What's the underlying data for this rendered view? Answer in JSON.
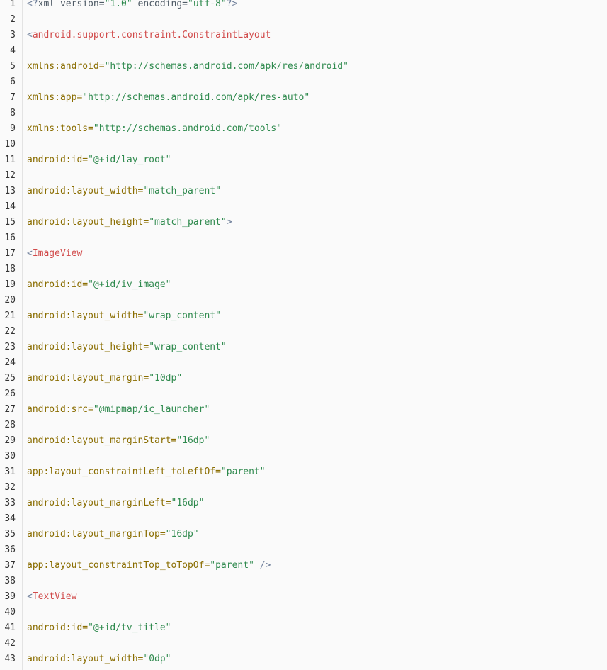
{
  "colors": {
    "background": "#fafafa",
    "line_number": "#333333",
    "gutter_border": "#e3e3e3",
    "punctuation": "#6f7f9a",
    "tag": "#d14a4a",
    "attribute": "#8a6d00",
    "string": "#2f8a4e",
    "plain_text": "#4f5b66"
  },
  "lines": [
    {
      "no": "1",
      "tokens": [
        {
          "type": "punct",
          "text": "<?"
        },
        {
          "type": "text",
          "text": "xml version="
        },
        {
          "type": "string",
          "text": "\"1.0\""
        },
        {
          "type": "text",
          "text": " encoding="
        },
        {
          "type": "string",
          "text": "\"utf-8\""
        },
        {
          "type": "punct",
          "text": "?>"
        }
      ]
    },
    {
      "no": "2",
      "tokens": []
    },
    {
      "no": "3",
      "tokens": [
        {
          "type": "punct",
          "text": "<"
        },
        {
          "type": "tag",
          "text": "android.support.constraint.ConstraintLayout"
        }
      ]
    },
    {
      "no": "4",
      "tokens": []
    },
    {
      "no": "5",
      "tokens": [
        {
          "type": "attr",
          "text": "xmlns:android="
        },
        {
          "type": "string",
          "text": "\"http://schemas.android.com/apk/res/android\""
        }
      ]
    },
    {
      "no": "6",
      "tokens": []
    },
    {
      "no": "7",
      "tokens": [
        {
          "type": "attr",
          "text": "xmlns:app="
        },
        {
          "type": "string",
          "text": "\"http://schemas.android.com/apk/res-auto\""
        }
      ]
    },
    {
      "no": "8",
      "tokens": []
    },
    {
      "no": "9",
      "tokens": [
        {
          "type": "attr",
          "text": "xmlns:tools="
        },
        {
          "type": "string",
          "text": "\"http://schemas.android.com/tools\""
        }
      ]
    },
    {
      "no": "10",
      "tokens": []
    },
    {
      "no": "11",
      "tokens": [
        {
          "type": "attr",
          "text": "android:id="
        },
        {
          "type": "string",
          "text": "\"@+id/lay_root\""
        }
      ]
    },
    {
      "no": "12",
      "tokens": []
    },
    {
      "no": "13",
      "tokens": [
        {
          "type": "attr",
          "text": "android:layout_width="
        },
        {
          "type": "string",
          "text": "\"match_parent\""
        }
      ]
    },
    {
      "no": "14",
      "tokens": []
    },
    {
      "no": "15",
      "tokens": [
        {
          "type": "attr",
          "text": "android:layout_height="
        },
        {
          "type": "string",
          "text": "\"match_parent\""
        },
        {
          "type": "punct",
          "text": ">"
        }
      ]
    },
    {
      "no": "16",
      "tokens": []
    },
    {
      "no": "17",
      "tokens": [
        {
          "type": "punct",
          "text": "<"
        },
        {
          "type": "tag",
          "text": "ImageView"
        }
      ]
    },
    {
      "no": "18",
      "tokens": []
    },
    {
      "no": "19",
      "tokens": [
        {
          "type": "attr",
          "text": "android:id="
        },
        {
          "type": "string",
          "text": "\"@+id/iv_image\""
        }
      ]
    },
    {
      "no": "20",
      "tokens": []
    },
    {
      "no": "21",
      "tokens": [
        {
          "type": "attr",
          "text": "android:layout_width="
        },
        {
          "type": "string",
          "text": "\"wrap_content\""
        }
      ]
    },
    {
      "no": "22",
      "tokens": []
    },
    {
      "no": "23",
      "tokens": [
        {
          "type": "attr",
          "text": "android:layout_height="
        },
        {
          "type": "string",
          "text": "\"wrap_content\""
        }
      ]
    },
    {
      "no": "24",
      "tokens": []
    },
    {
      "no": "25",
      "tokens": [
        {
          "type": "attr",
          "text": "android:layout_margin="
        },
        {
          "type": "string",
          "text": "\"10dp\""
        }
      ]
    },
    {
      "no": "26",
      "tokens": []
    },
    {
      "no": "27",
      "tokens": [
        {
          "type": "attr",
          "text": "android:src="
        },
        {
          "type": "string",
          "text": "\"@mipmap/ic_launcher\""
        }
      ]
    },
    {
      "no": "28",
      "tokens": []
    },
    {
      "no": "29",
      "tokens": [
        {
          "type": "attr",
          "text": "android:layout_marginStart="
        },
        {
          "type": "string",
          "text": "\"16dp\""
        }
      ]
    },
    {
      "no": "30",
      "tokens": []
    },
    {
      "no": "31",
      "tokens": [
        {
          "type": "attr",
          "text": "app:layout_constraintLeft_toLeftOf="
        },
        {
          "type": "string",
          "text": "\"parent\""
        }
      ]
    },
    {
      "no": "32",
      "tokens": []
    },
    {
      "no": "33",
      "tokens": [
        {
          "type": "attr",
          "text": "android:layout_marginLeft="
        },
        {
          "type": "string",
          "text": "\"16dp\""
        }
      ]
    },
    {
      "no": "34",
      "tokens": []
    },
    {
      "no": "35",
      "tokens": [
        {
          "type": "attr",
          "text": "android:layout_marginTop="
        },
        {
          "type": "string",
          "text": "\"16dp\""
        }
      ]
    },
    {
      "no": "36",
      "tokens": []
    },
    {
      "no": "37",
      "tokens": [
        {
          "type": "attr",
          "text": "app:layout_constraintTop_toTopOf="
        },
        {
          "type": "string",
          "text": "\"parent\""
        },
        {
          "type": "punct",
          "text": " />"
        }
      ]
    },
    {
      "no": "38",
      "tokens": []
    },
    {
      "no": "39",
      "tokens": [
        {
          "type": "punct",
          "text": "<"
        },
        {
          "type": "tag",
          "text": "TextView"
        }
      ]
    },
    {
      "no": "40",
      "tokens": []
    },
    {
      "no": "41",
      "tokens": [
        {
          "type": "attr",
          "text": "android:id="
        },
        {
          "type": "string",
          "text": "\"@+id/tv_title\""
        }
      ]
    },
    {
      "no": "42",
      "tokens": []
    },
    {
      "no": "43",
      "tokens": [
        {
          "type": "attr",
          "text": "android:layout_width="
        },
        {
          "type": "string",
          "text": "\"0dp\""
        }
      ]
    }
  ]
}
